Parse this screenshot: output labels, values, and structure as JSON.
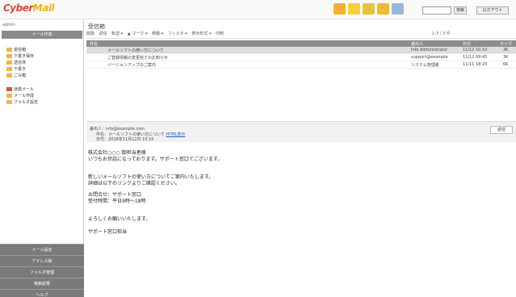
{
  "header": {
    "logo_a": "Cyber",
    "logo_b": "Mail",
    "search_button": "検索",
    "logout_button": "ログアウト",
    "icons": [
      "mail-icon",
      "address-icon",
      "schedule-icon",
      "file-icon",
      "settings-icon"
    ]
  },
  "sidebar": {
    "user": "admin",
    "new_mail": "メール作成",
    "folders": [
      "受信箱",
      "下書き保存",
      "送信済",
      "下書き",
      "ごみ箱",
      "迷惑メール",
      "メール作成",
      "フォルダ設定"
    ],
    "buttons": [
      "メール設定",
      "アドレス帳",
      "フォルダ管理",
      "検索結果",
      "ヘルプ"
    ]
  },
  "main": {
    "title": "受信箱",
    "toolbar": [
      "削除",
      "返信",
      "転送 ▾",
      "▲ マーク ▾",
      "移動 ▾",
      "フィルタ ▾",
      "表示形式 ▾",
      "印刷"
    ],
    "pager": "1-3 / 3 件",
    "columns": {
      "subject": "件名",
      "from": "差出人",
      "date": "日付",
      "size": "サイズ"
    },
    "rows": [
      {
        "subject": "メールソフトの使い方について",
        "from": "Info Administrator",
        "date": "11/12 10:10",
        "size": "3K"
      },
      {
        "subject": "ご登録情報の変更完了のお知らせ",
        "from": "support@example",
        "date": "11/12 09:45",
        "size": "3K"
      },
      {
        "subject": "バージョンアップのご案内",
        "from": "システム管理者",
        "date": "11/11 18:20",
        "size": "6K"
      }
    ]
  },
  "preview": {
    "from_line": "差出人：info@example.com",
    "subject_label": "件名：",
    "subject_value": "メールソフトの使い方について",
    "subject_link": "HTML表示",
    "date_line": "日付：2016年11月12日 10:10",
    "reply_button": "返信",
    "body": [
      "株式会社○○○ 御担当者様",
      "いつもお世話になっております。サポート窓口でございます。",
      "",
      "新しいメールソフトの使い方についてご案内いたします。",
      "詳細は以下のリンクよりご確認ください。",
      "",
      "お問合せ：サポート窓口",
      "受付時間：平日9時〜18時",
      "",
      "よろしくお願いいたします。",
      "",
      "サポート窓口担当"
    ]
  }
}
